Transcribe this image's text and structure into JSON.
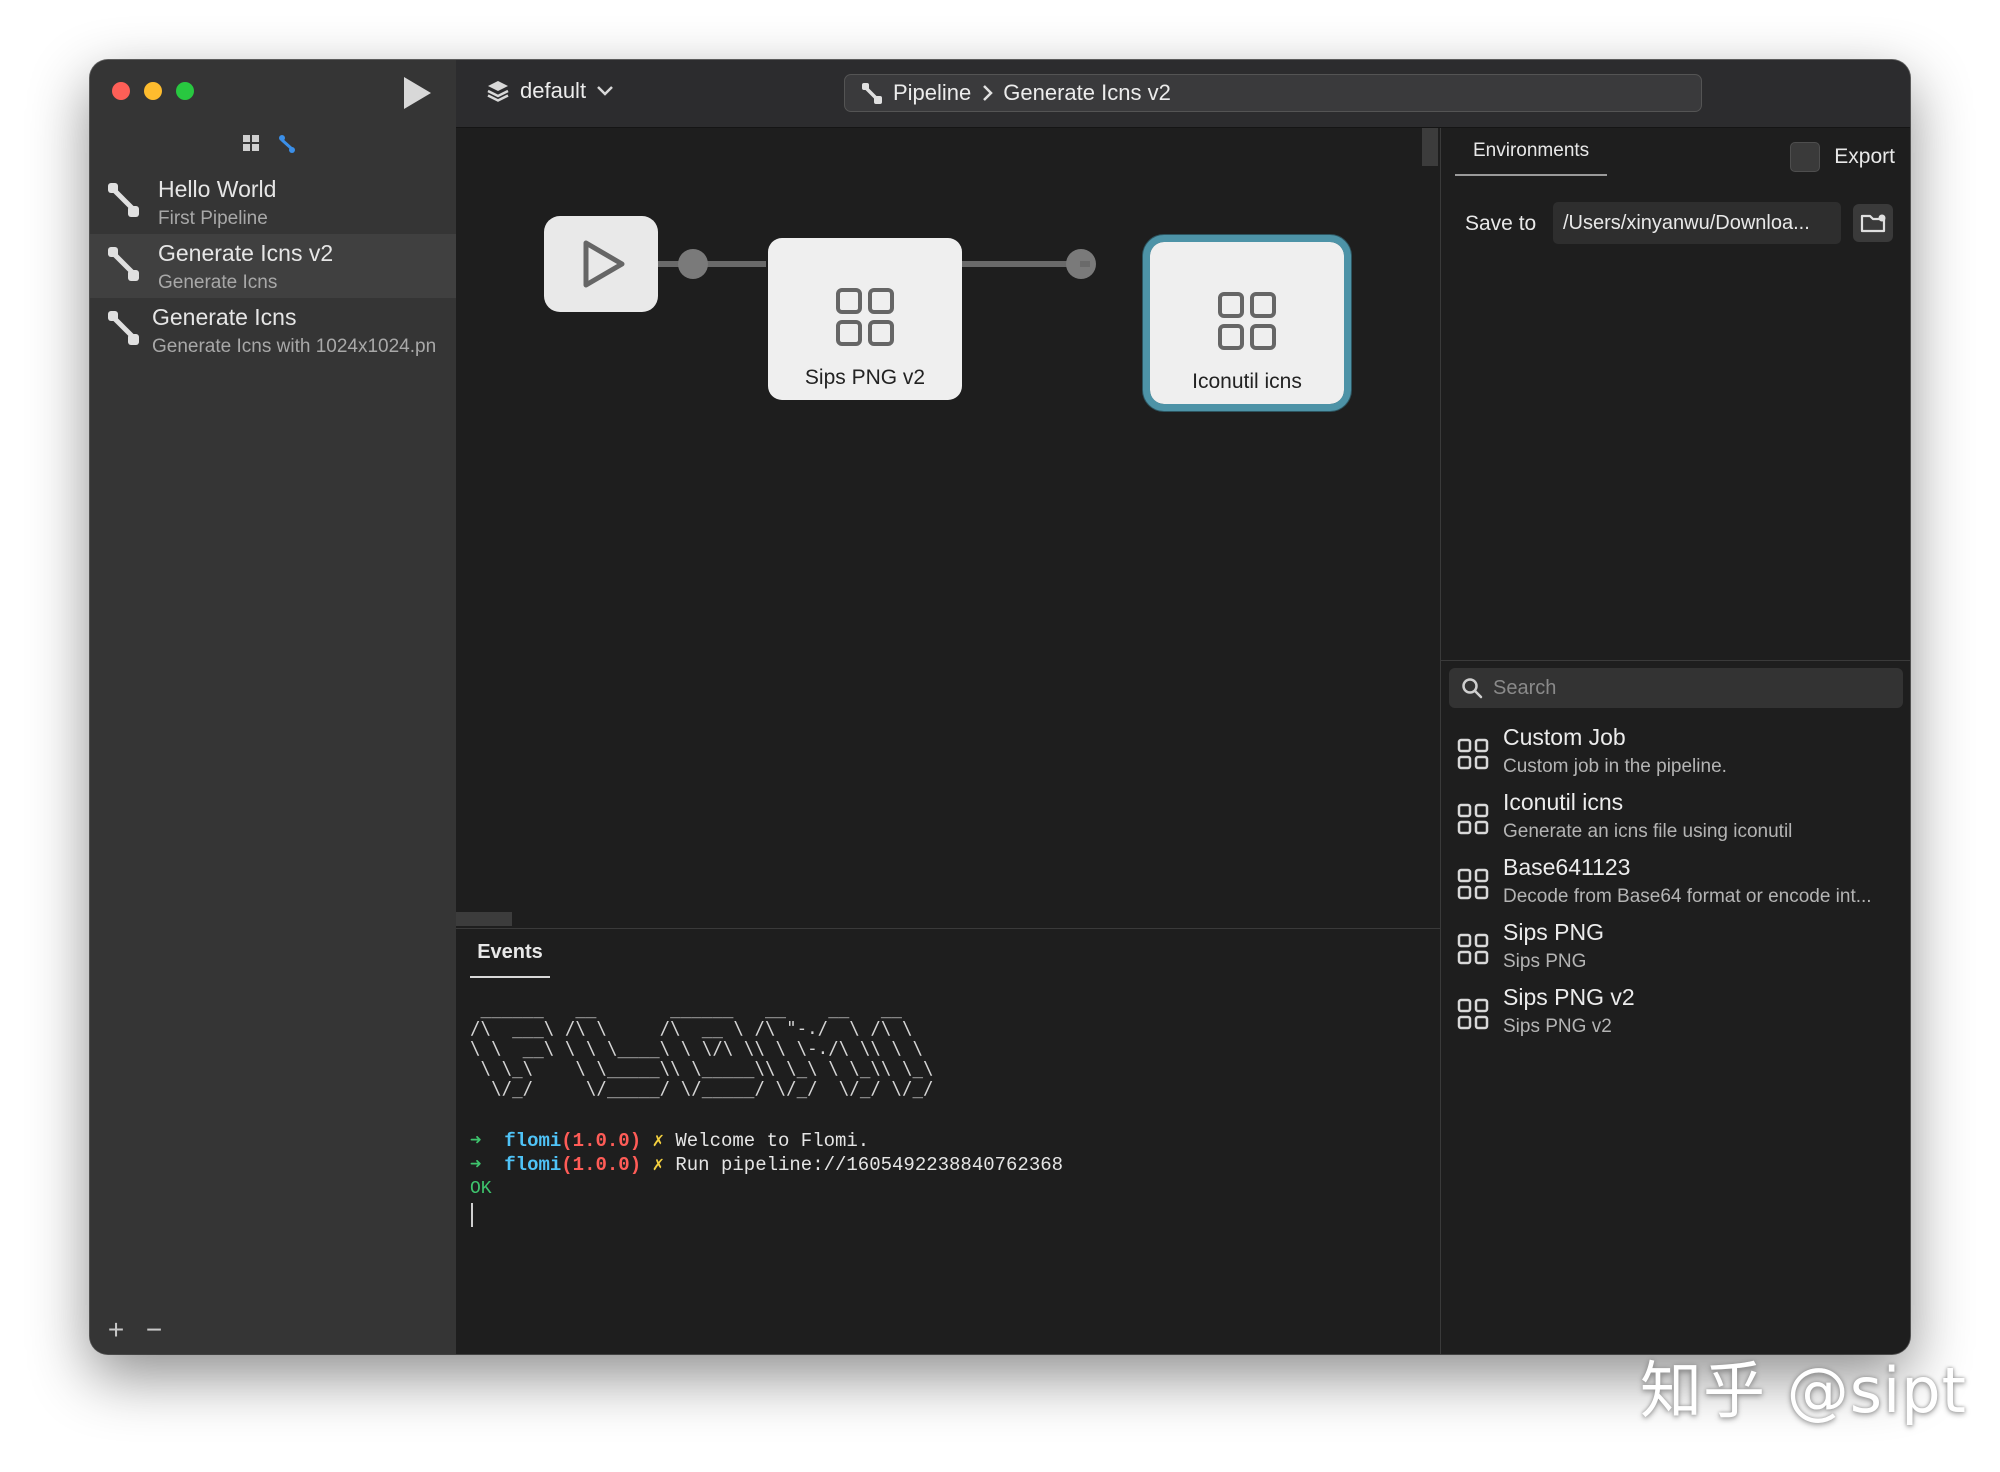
{
  "window": {
    "scheme": "default",
    "breadcrumb": {
      "root": "Pipeline",
      "current": "Generate Icns v2"
    }
  },
  "sidebar": {
    "items": [
      {
        "title": "Hello World",
        "subtitle": "First Pipeline",
        "selected": false
      },
      {
        "title": "Generate Icns v2",
        "subtitle": "Generate Icns",
        "selected": true
      },
      {
        "title": "Generate Icns",
        "subtitle": "Generate Icns with 1024x1024.pn",
        "selected": false
      }
    ],
    "add_label": "+",
    "remove_label": "−"
  },
  "canvas": {
    "nodes": [
      {
        "label": "Sips PNG v2",
        "active": false
      },
      {
        "label": "Iconutil icns",
        "active": true
      }
    ]
  },
  "events": {
    "tab": "Events",
    "ascii_banner": " ______   __       ______   __    __   __    \n/\\  ___\\ /\\ \\     /\\  __ \\ /\\ \"-./  \\ /\\ \\   \n\\ \\  __\\ \\ \\ \\____\\ \\ \\/\\ \\\\ \\ \\-./\\ \\\\ \\ \\  \n \\ \\_\\    \\ \\_____\\\\ \\_____\\\\ \\_\\ \\ \\_\\\\ \\_\\ \n  \\/_/     \\/_____/ \\/_____/ \\/_/  \\/_/ \\/_/ ",
    "lines": [
      {
        "arrow": "➜",
        "name": "flomi",
        "version": "(1.0.0)",
        "mark": "✗",
        "message": "Welcome to Flomi."
      },
      {
        "arrow": "➜",
        "name": "flomi",
        "version": "(1.0.0)",
        "mark": "✗",
        "message": "Run pipeline://1605492238840762368"
      }
    ],
    "status": "OK"
  },
  "right_panel": {
    "tab": "Environments",
    "export_label": "Export",
    "save_to_label": "Save to",
    "save_path": "/Users/xinyanwu/Downloa...",
    "search_placeholder": "Search",
    "library": [
      {
        "name": "Custom Job",
        "desc": "Custom job in the pipeline."
      },
      {
        "name": "Iconutil icns",
        "desc": "Generate an icns file using iconutil"
      },
      {
        "name": "Base641123",
        "desc": "Decode from Base64 format or encode int..."
      },
      {
        "name": "Sips PNG",
        "desc": "Sips PNG"
      },
      {
        "name": "Sips PNG v2",
        "desc": "Sips PNG v2"
      }
    ]
  },
  "watermark": "知乎 @sipt",
  "colors": {
    "active_node_border": "#4d93a7",
    "log_arrow": "#3ec46d",
    "log_name": "#4fc3f7",
    "log_version": "#ff5c57",
    "log_mark": "#f4d03f"
  }
}
